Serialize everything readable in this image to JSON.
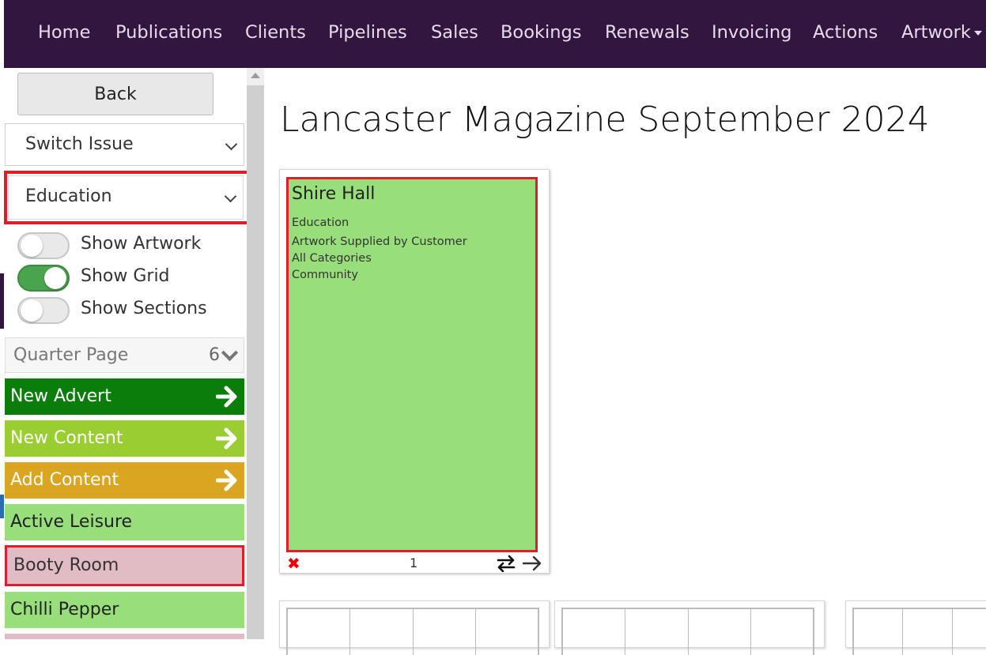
{
  "nav": {
    "items": [
      "Home",
      "Publications",
      "Clients",
      "Pipelines",
      "Sales",
      "Bookings",
      "Renewals",
      "Invoicing",
      "Actions",
      "Artwork"
    ]
  },
  "sidebar": {
    "back_label": "Back",
    "switch_issue": "Switch Issue",
    "section_select": "Education",
    "toggles": [
      {
        "label": "Show Artwork",
        "on": false
      },
      {
        "label": "Show Grid",
        "on": true
      },
      {
        "label": "Show Sections",
        "on": false
      }
    ],
    "size_group": {
      "label": "Quarter Page",
      "count": "6"
    },
    "actions": [
      {
        "label": "New Advert",
        "color": "#0a7d0a"
      },
      {
        "label": "New Content",
        "color": "#9acd32"
      },
      {
        "label": "Add Content",
        "color": "#daa520"
      }
    ],
    "clients": [
      {
        "label": "Active Leisure",
        "color": "#98df7c"
      },
      {
        "label": "Booty Room",
        "color": "#e2bcc4"
      },
      {
        "label": "Chilli Pepper",
        "color": "#98df7c"
      }
    ]
  },
  "main": {
    "title": "Lancaster Magazine September 2024",
    "page": {
      "number": "1",
      "ad": {
        "name": "Shire Hall",
        "section": "Education",
        "lines": [
          "Artwork Supplied by Customer",
          "All Categories",
          "Community"
        ]
      }
    }
  },
  "colors": {
    "topbar": "#32163f",
    "highlight": "#e21d2a",
    "ad_fill": "#98df7c"
  }
}
